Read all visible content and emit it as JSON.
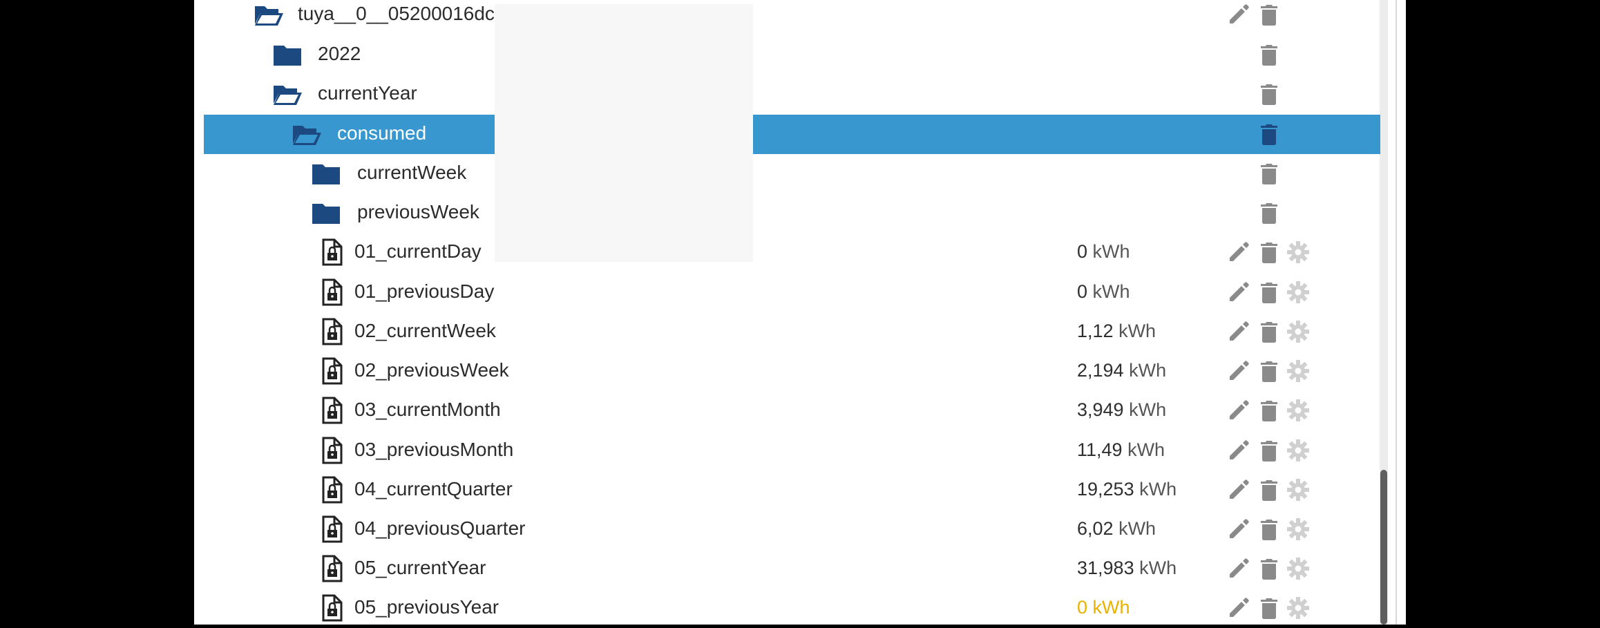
{
  "tree": {
    "rows": [
      {
        "label": "tuya__0__05200016dc",
        "kind": "folder-open",
        "actions": [
          "pencil",
          "trash"
        ]
      },
      {
        "label": "2022",
        "kind": "folder",
        "actions": [
          "trash"
        ]
      },
      {
        "label": "currentYear",
        "kind": "folder-open",
        "actions": [
          "trash"
        ]
      },
      {
        "label": "consumed",
        "kind": "folder-open",
        "selected": true,
        "actions": [
          "trash"
        ]
      },
      {
        "label": "currentWeek",
        "kind": "folder",
        "actions": [
          "trash"
        ]
      },
      {
        "label": "previousWeek",
        "kind": "folder",
        "actions": [
          "trash"
        ]
      },
      {
        "label": "01_currentDay",
        "kind": "state",
        "value": "0",
        "unit": "kWh",
        "actions": [
          "pencil",
          "trash",
          "gear"
        ]
      },
      {
        "label": "01_previousDay",
        "kind": "state",
        "value": "0",
        "unit": "kWh",
        "actions": [
          "pencil",
          "trash",
          "gear"
        ]
      },
      {
        "label": "02_currentWeek",
        "kind": "state",
        "value": "1,12",
        "unit": "kWh",
        "actions": [
          "pencil",
          "trash",
          "gear"
        ]
      },
      {
        "label": "02_previousWeek",
        "kind": "state",
        "value": "2,194",
        "unit": "kWh",
        "actions": [
          "pencil",
          "trash",
          "gear"
        ]
      },
      {
        "label": "03_currentMonth",
        "kind": "state",
        "value": "3,949",
        "unit": "kWh",
        "actions": [
          "pencil",
          "trash",
          "gear"
        ]
      },
      {
        "label": "03_previousMonth",
        "kind": "state",
        "value": "11,49",
        "unit": "kWh",
        "actions": [
          "pencil",
          "trash",
          "gear"
        ]
      },
      {
        "label": "04_currentQuarter",
        "kind": "state",
        "value": "19,253",
        "unit": "kWh",
        "actions": [
          "pencil",
          "trash",
          "gear"
        ]
      },
      {
        "label": "04_previousQuarter",
        "kind": "state",
        "value": "6,02",
        "unit": "kWh",
        "actions": [
          "pencil",
          "trash",
          "gear"
        ]
      },
      {
        "label": "05_currentYear",
        "kind": "state",
        "value": "31,983",
        "unit": "kWh",
        "actions": [
          "pencil",
          "trash",
          "gear"
        ]
      },
      {
        "label": "05_previousYear",
        "kind": "state",
        "value": "0",
        "unit": "kWh",
        "value_color": "#e8b200",
        "actions": [
          "pencil",
          "trash",
          "gear"
        ]
      }
    ]
  },
  "colors": {
    "selection": "#3797ce",
    "folder_icon": "#1c4a80",
    "action_icon": "#8a8a8a",
    "gear_icon": "#d0d0d0",
    "warn_value": "#e8b200"
  }
}
